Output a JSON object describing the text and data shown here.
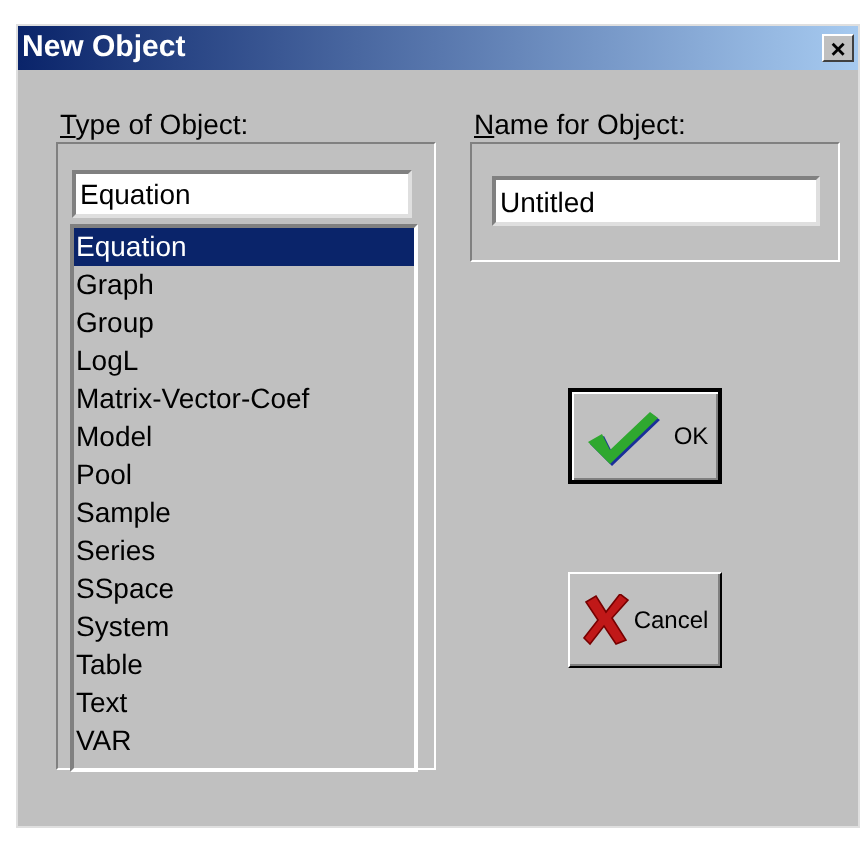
{
  "window": {
    "title": "New Object",
    "close": "×"
  },
  "type_group": {
    "label": "Type of Object:",
    "value": "Equation",
    "items": [
      {
        "label": "Equation",
        "selected": true
      },
      {
        "label": "Graph",
        "selected": false
      },
      {
        "label": "Group",
        "selected": false
      },
      {
        "label": "LogL",
        "selected": false
      },
      {
        "label": "Matrix-Vector-Coef",
        "selected": false
      },
      {
        "label": "Model",
        "selected": false
      },
      {
        "label": "Pool",
        "selected": false
      },
      {
        "label": "Sample",
        "selected": false
      },
      {
        "label": "Series",
        "selected": false
      },
      {
        "label": "SSpace",
        "selected": false
      },
      {
        "label": "System",
        "selected": false
      },
      {
        "label": "Table",
        "selected": false
      },
      {
        "label": "Text",
        "selected": false
      },
      {
        "label": "VAR",
        "selected": false
      }
    ]
  },
  "name_group": {
    "label": "Name for Object:",
    "value": "Untitled"
  },
  "buttons": [
    {
      "label": "OK",
      "kind": "ok",
      "default": true
    },
    {
      "label": "Cancel",
      "kind": "cancel",
      "default": false
    }
  ]
}
